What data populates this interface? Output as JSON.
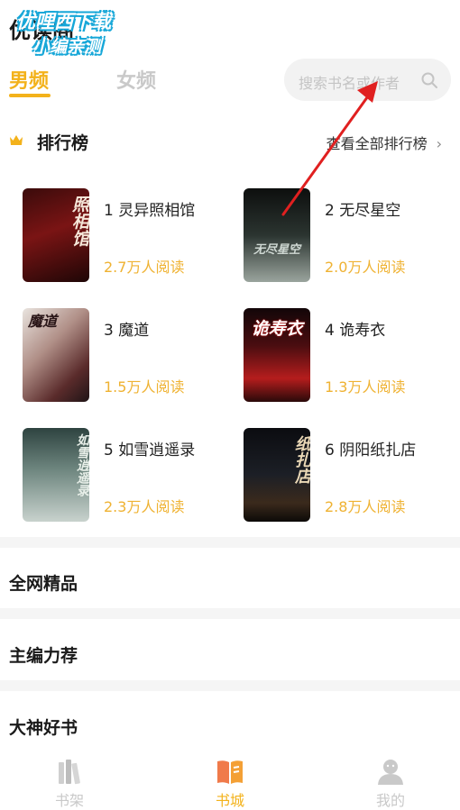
{
  "app": {
    "title": "优读阁"
  },
  "watermark": {
    "line1": "优哩西下载",
    "line2": "小编亲测"
  },
  "tabs": [
    {
      "label": "男频",
      "active": true
    },
    {
      "label": "女频",
      "active": false
    }
  ],
  "search": {
    "placeholder": "搜索书名或作者",
    "icon": "search-icon"
  },
  "ranking": {
    "title": "排行榜",
    "icon": "crown-icon",
    "view_all": "查看全部排行榜",
    "view_all_chevron": "›",
    "books": [
      {
        "name": "1 灵异照相馆",
        "reads": "2.7万人阅读",
        "cover_text": "照相馆"
      },
      {
        "name": "2 无尽星空",
        "reads": "2.0万人阅读",
        "cover_text": "无尽星空"
      },
      {
        "name": "3 魔道",
        "reads": "1.5万人阅读",
        "cover_text": "魔道"
      },
      {
        "name": "4 诡寿衣",
        "reads": "1.3万人阅读",
        "cover_text": "诡寿衣"
      },
      {
        "name": "5 如雪逍遥录",
        "reads": "2.3万人阅读",
        "cover_text": "如雪逍遥录"
      },
      {
        "name": "6 阴阳纸扎店",
        "reads": "2.8万人阅读",
        "cover_text": "纸扎店"
      }
    ]
  },
  "sections": [
    {
      "title": "全网精品"
    },
    {
      "title": "主编力荐"
    },
    {
      "title": "大神好书"
    }
  ],
  "bottom_nav": [
    {
      "label": "书架",
      "icon": "bookshelf-icon",
      "active": false
    },
    {
      "label": "书城",
      "icon": "bookstore-icon",
      "active": true
    },
    {
      "label": "我的",
      "icon": "profile-icon",
      "active": false
    }
  ],
  "colors": {
    "accent": "#f3b21b",
    "reads": "#efb232",
    "annotation_arrow": "#e02020",
    "watermark": "#17a7d8"
  }
}
